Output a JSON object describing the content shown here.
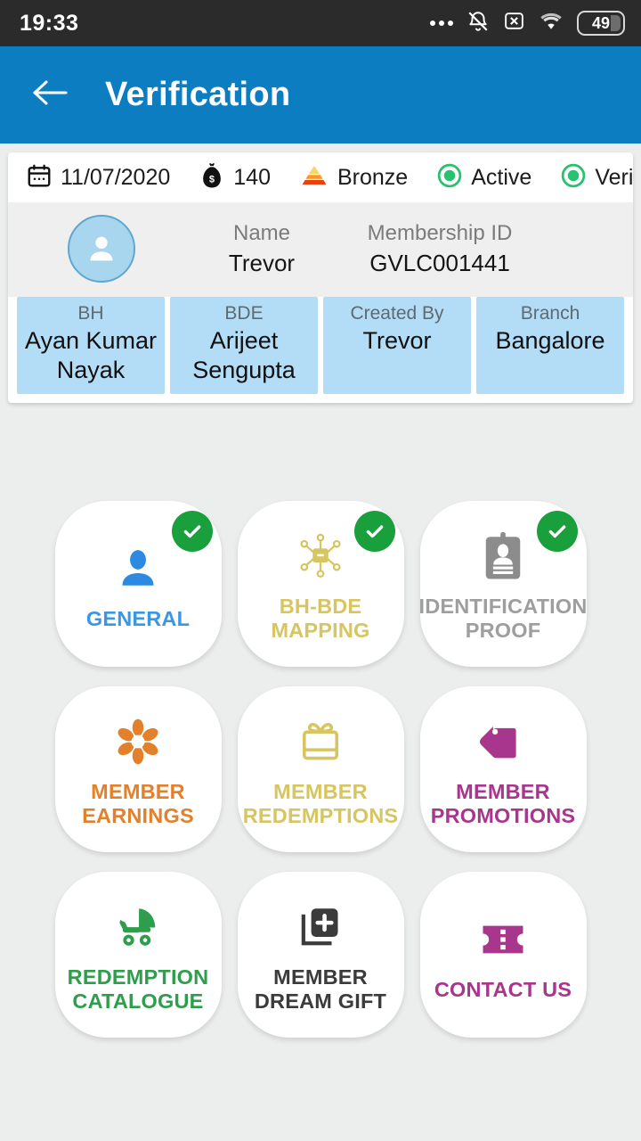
{
  "status_bar": {
    "time": "19:33",
    "battery_level": "49",
    "icons": [
      "more-dots-icon",
      "bell-muted-icon",
      "sim-missing-icon",
      "wifi-icon",
      "battery-icon"
    ]
  },
  "app_bar": {
    "back_icon": "back-arrow-icon",
    "title": "Verification",
    "color": "#0d7dc1"
  },
  "member_card": {
    "summary": {
      "date": "11/07/2020",
      "points": "140",
      "tier": "Bronze",
      "status": "Active",
      "verification": "Verified",
      "status_color": "#27c26d"
    },
    "profile": {
      "avatar_icon": "person-avatar-icon",
      "name_label": "Name",
      "name_value": "Trevor",
      "membership_label": "Membership ID",
      "membership_value": "GVLC001441"
    },
    "chips": [
      {
        "label": "BH",
        "value": "Ayan Kumar Nayak"
      },
      {
        "label": "BDE",
        "value": "Arijeet Sengupta"
      },
      {
        "label": "Created By",
        "value": "Trevor"
      },
      {
        "label": "Branch",
        "value": "Bangalore"
      }
    ],
    "chip_color": "#b3dcf7"
  },
  "tiles": [
    {
      "id": "general",
      "label": "GENERAL",
      "color": "#3b96e3",
      "icon": "person-icon",
      "verified": true
    },
    {
      "id": "bh-bde-mapping",
      "label": "BH-BDE MAPPING",
      "color": "#d6c561",
      "icon": "network-node-icon",
      "verified": true
    },
    {
      "id": "identification-proof",
      "label": "IDENTIFICATION PROOF",
      "color": "#9e9e9e",
      "icon": "id-badge-icon",
      "verified": true
    },
    {
      "id": "member-earnings",
      "label": "MEMBER EARNINGS",
      "color": "#e2802c",
      "icon": "flower-icon",
      "verified": false
    },
    {
      "id": "member-redemptions",
      "label": "MEMBER REDEMPTIONS",
      "color": "#d6c561",
      "icon": "gift-icon",
      "verified": false
    },
    {
      "id": "member-promotions",
      "label": "MEMBER PROMOTIONS",
      "color": "#a8368c",
      "icon": "price-tag-icon",
      "verified": false
    },
    {
      "id": "redemption-catalogue",
      "label": "REDEMPTION CATALOGUE",
      "color": "#2e9e4c",
      "icon": "stroller-icon",
      "verified": false
    },
    {
      "id": "member-dream-gift",
      "label": "MEMBER DREAM GIFT",
      "color": "#3b3b3b",
      "icon": "add-document-icon",
      "verified": false
    },
    {
      "id": "contact-us",
      "label": "CONTACT US",
      "color": "#a8368c",
      "icon": "ticket-icon",
      "verified": false
    }
  ]
}
